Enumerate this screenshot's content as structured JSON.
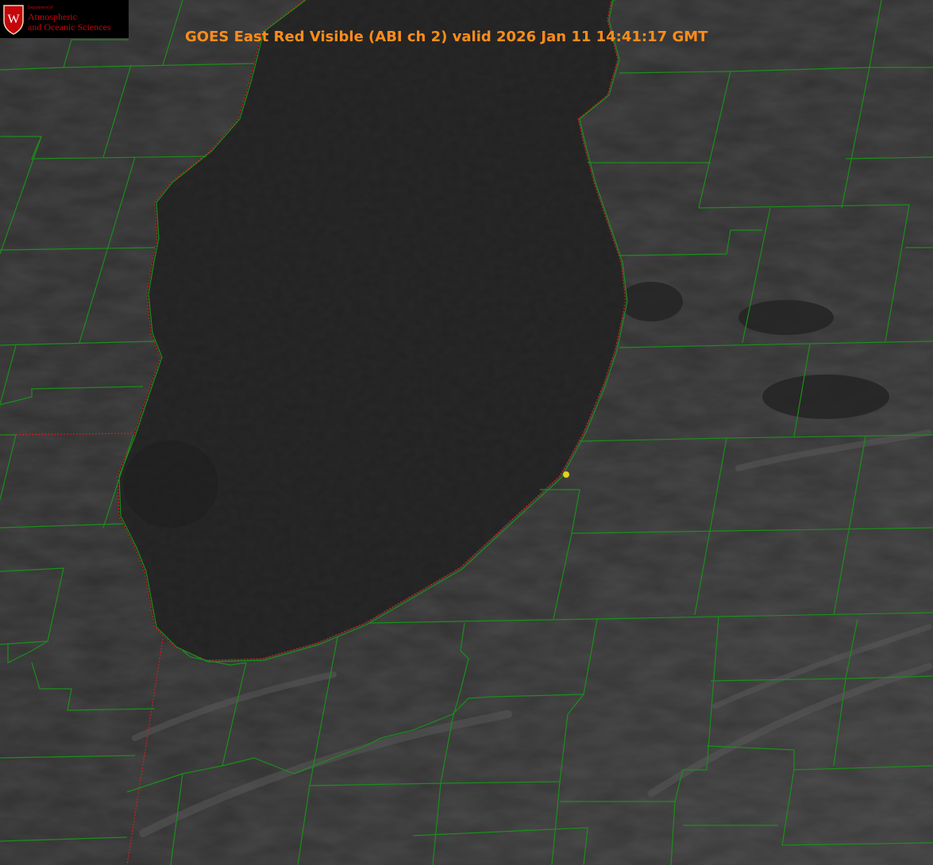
{
  "title": "GOES East Red Visible (ABI ch 2) valid 2026 Jan 11 14:41:17 GMT",
  "logo": {
    "department": "Department of",
    "line1": "Atmospheric",
    "line2": "and Oceanic Sciences",
    "seal_letter": "W"
  },
  "colors": {
    "title": "#ff8c1a",
    "county_lines": "#1a8f1a",
    "state_border": "#d21e1e",
    "marker": "#e6d21e",
    "logo_text": "#c5050c",
    "imagery_land": "#2f2f2f",
    "imagery_lake": "#262626"
  },
  "icons": {
    "marker": "yellow-dot-marker-icon",
    "seal": "uw-crest-icon"
  }
}
